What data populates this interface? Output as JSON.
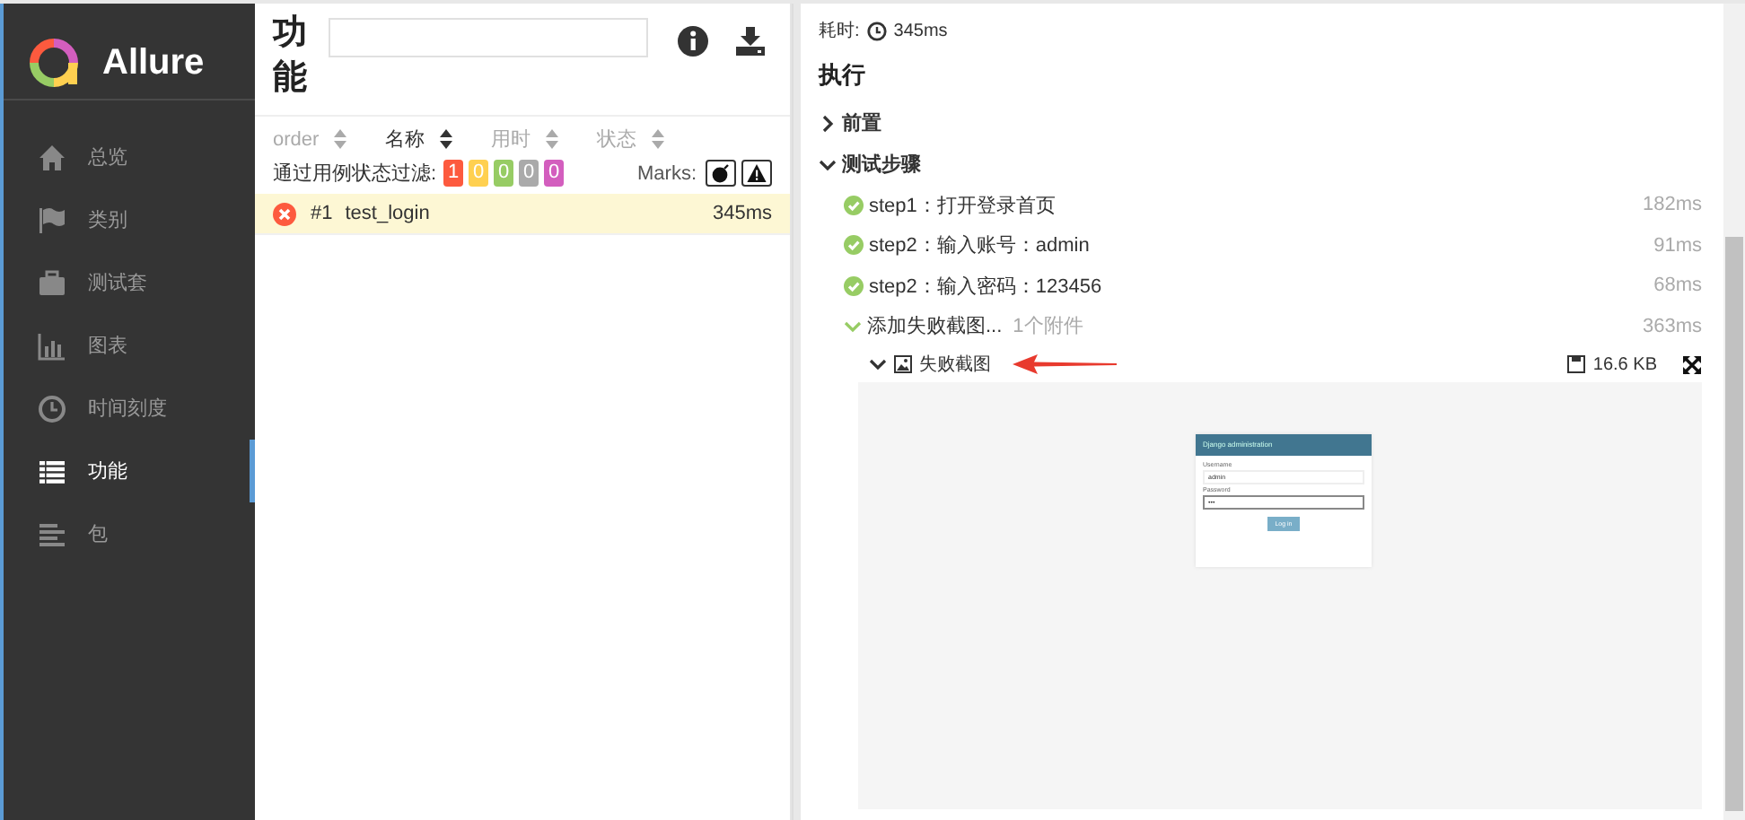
{
  "brand": {
    "name": "Allure"
  },
  "sidebar": {
    "items": [
      {
        "label": "总览",
        "selected": false
      },
      {
        "label": "类别",
        "selected": false
      },
      {
        "label": "测试套",
        "selected": false
      },
      {
        "label": "图表",
        "selected": false
      },
      {
        "label": "时间刻度",
        "selected": false
      },
      {
        "label": "功能",
        "selected": true
      },
      {
        "label": "包",
        "selected": false
      }
    ]
  },
  "list_panel": {
    "title": "功能",
    "sort_columns": [
      {
        "label": "order",
        "active": false
      },
      {
        "label": "名称",
        "active": true
      },
      {
        "label": "用时",
        "active": false
      },
      {
        "label": "状态",
        "active": false
      }
    ],
    "filter_label": "通过用例状态过滤:",
    "status_filters": [
      {
        "count": "1",
        "color": "#fd5a3e"
      },
      {
        "count": "0",
        "color": "#ffd050"
      },
      {
        "count": "0",
        "color": "#97cc64"
      },
      {
        "count": "0",
        "color": "#aaaaaa"
      },
      {
        "count": "0",
        "color": "#d35ebe"
      }
    ],
    "marks_label": "Marks:",
    "rows": [
      {
        "kind": "failed",
        "number": "#1",
        "name": "test_login",
        "duration": "345ms",
        "selected": true
      }
    ]
  },
  "detail": {
    "duration_label": "耗时:",
    "duration": "345ms",
    "section_title": "执行",
    "groups": [
      {
        "title": "前置",
        "expanded": false
      },
      {
        "title": "测试步骤",
        "expanded": true,
        "steps": [
          {
            "kind": "passed",
            "name": "step1：打开登录首页",
            "duration": "182ms"
          },
          {
            "kind": "passed",
            "name": "step2：输入账号：admin",
            "duration": "91ms"
          },
          {
            "kind": "passed",
            "name": "step2：输入密码：123456",
            "duration": "68ms"
          },
          {
            "kind": "passed",
            "name": "添加失败截图...",
            "attachments": "1个附件",
            "duration": "363ms",
            "expanded": true,
            "attachment": {
              "name": "失败截图",
              "size": "16.6 KB",
              "expanded": true,
              "screenshot": {
                "title": "Django administration",
                "fields": [
                  {
                    "label": "Username",
                    "value": "admin"
                  },
                  {
                    "label": "Password",
                    "value": "•••"
                  }
                ],
                "button": "Log in"
              }
            }
          }
        ]
      }
    ]
  }
}
